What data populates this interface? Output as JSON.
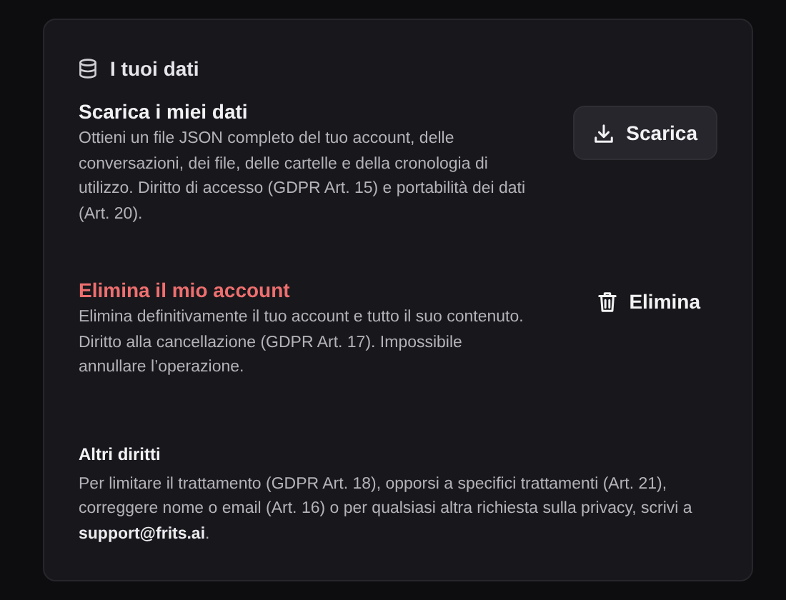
{
  "card": {
    "title": "I tuoi dati",
    "sections": [
      {
        "kind": "action",
        "title": "Scarica i miei dati",
        "danger": false,
        "description": "Ottieni un file JSON completo del tuo account, delle conversazioni, dei file, delle cartelle e della cronologia di utilizzo. Diritto di accesso (GDPR Art. 15) e portabilità dei dati (Art. 20).",
        "button": {
          "kind": "download",
          "label": "Scarica"
        }
      },
      {
        "kind": "action",
        "title": "Elimina il mio account",
        "danger": true,
        "description": "Elimina definitivamente il tuo account e tutto il suo contenuto. Diritto alla cancellazione (GDPR Art. 17). Impossibile annullare l’operazione.",
        "button": {
          "kind": "delete",
          "label": "Elimina"
        }
      },
      {
        "kind": "note",
        "title": "Altri diritti",
        "description": "Per limitare il trattamento (GDPR Art. 18), opporsi a specifici trattamenti (Art. 21), correggere nome o email (Art. 16) o per qualsiasi altra richiesta sulla privacy, scrivi a **support@frits.ai**."
      }
    ]
  }
}
